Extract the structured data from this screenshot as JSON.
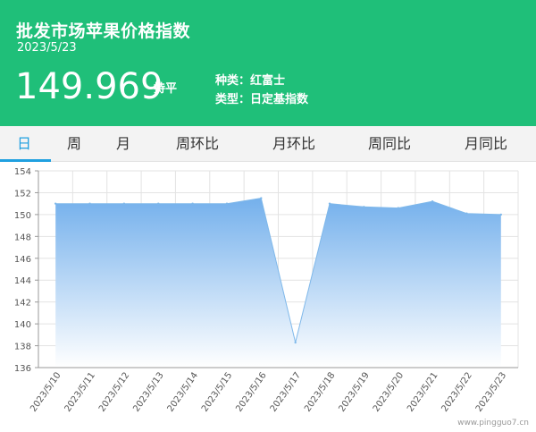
{
  "header": {
    "title": "批发市场苹果价格指数",
    "date": "2023/5/23",
    "value": "149.969",
    "change": "持平",
    "variety": "种类：红富士",
    "type": "类型：日定基指数"
  },
  "tabs": [
    "日",
    "周",
    "月",
    "周环比",
    "月环比",
    "周同比",
    "月同比"
  ],
  "watermark": "www.pingguo7.cn",
  "chart_data": {
    "type": "area",
    "x": [
      "2023/5/10",
      "2023/5/11",
      "2023/5/12",
      "2023/5/13",
      "2023/5/14",
      "2023/5/15",
      "2023/5/16",
      "2023/5/17",
      "2023/5/18",
      "2023/5/19",
      "2023/5/20",
      "2023/5/21",
      "2023/5/22",
      "2023/5/23"
    ],
    "values": [
      151.0,
      151.0,
      151.0,
      151.0,
      151.0,
      151.0,
      151.5,
      138.3,
      151.0,
      150.7,
      150.6,
      151.2,
      150.1,
      150.0
    ],
    "ylim": [
      136,
      154
    ],
    "yticks": [
      136,
      138,
      140,
      142,
      144,
      146,
      148,
      150,
      152,
      154
    ],
    "title": "",
    "xlabel": "",
    "ylabel": "",
    "colors": {
      "line": "#7fb8ea",
      "fill_top": "#74b0ec",
      "fill_bottom": "#ffffff"
    }
  }
}
